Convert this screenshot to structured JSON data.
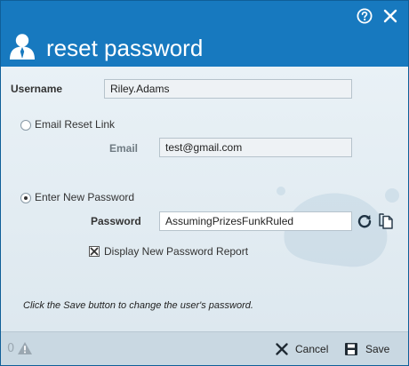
{
  "header": {
    "title": "reset password",
    "help_icon": "question-circle-icon",
    "close_icon": "close-icon",
    "user_icon": "user-silhouette-icon"
  },
  "form": {
    "username_label": "Username",
    "username_value": "Riley.Adams",
    "email_reset_label": "Email Reset Link",
    "email_label": "Email",
    "email_value": "test@gmail.com",
    "new_password_option_label": "Enter New Password",
    "password_label": "Password",
    "password_value": "AssumingPrizesFunkRuled",
    "display_report_label": "Display New Password Report",
    "note": "Click the Save button to change the user's password."
  },
  "footer": {
    "warning_count": "0",
    "cancel_label": "Cancel",
    "save_label": "Save"
  },
  "colors": {
    "header_bg": "#1779bf",
    "body_bg": "#e3ecf2",
    "footer_bg": "#c9d8e2"
  },
  "state": {
    "selected_option": "Enter New Password",
    "display_report_checked": true
  }
}
